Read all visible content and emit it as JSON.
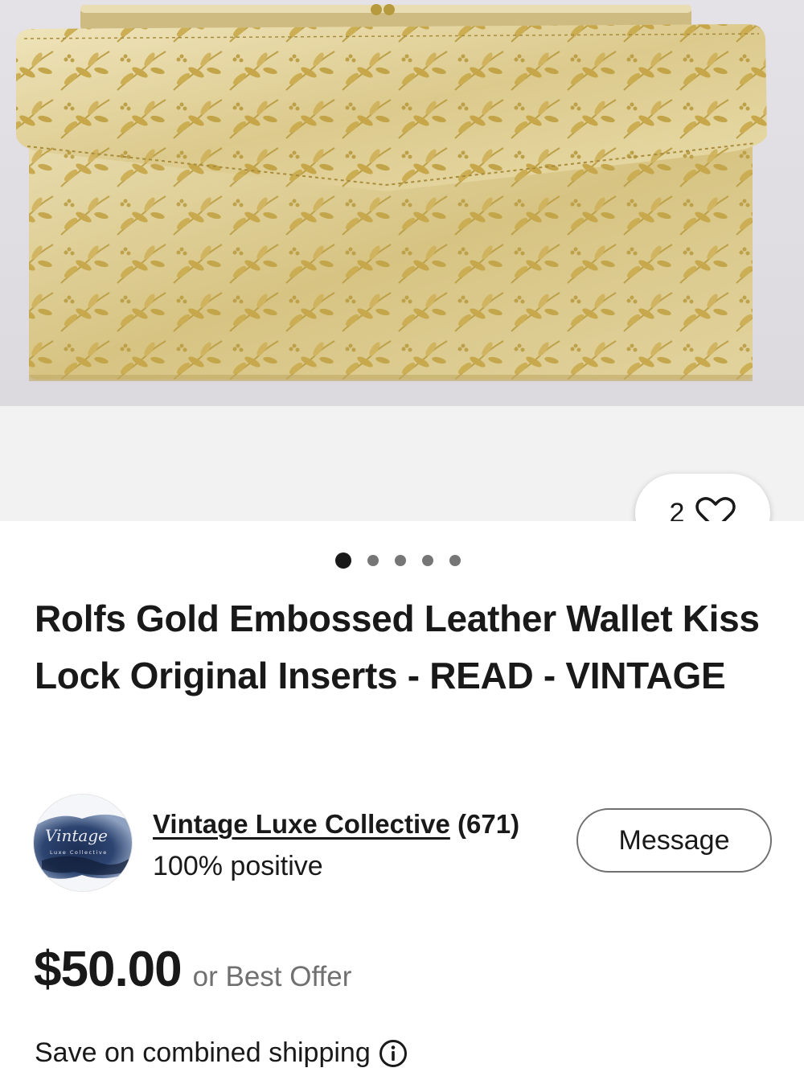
{
  "gallery": {
    "image_alt": "Rolfs gold embossed leather wallet with floral leaf pattern",
    "watch_count": "2",
    "watch_icon": "heart-outline-icon",
    "page_count": 5,
    "current_page": 1
  },
  "listing": {
    "title": "Rolfs Gold Embossed Leather Wallet Kiss Lock Original Inserts - READ - VINTAGE"
  },
  "seller": {
    "avatar_text": "Vintage",
    "avatar_subtext": "Luxe Collective",
    "name": "Vintage Luxe Collective",
    "count": "(671)",
    "feedback": "100% positive",
    "message_label": "Message"
  },
  "price": {
    "amount": "$50.00",
    "offer": "or Best Offer"
  },
  "shipping": {
    "text": "Save on combined shipping",
    "icon": "info-icon"
  },
  "colors": {
    "text": "#191919",
    "muted": "#707070",
    "gallery_background": "#f2f2f2",
    "wallet_gold": "#d9c58a"
  }
}
